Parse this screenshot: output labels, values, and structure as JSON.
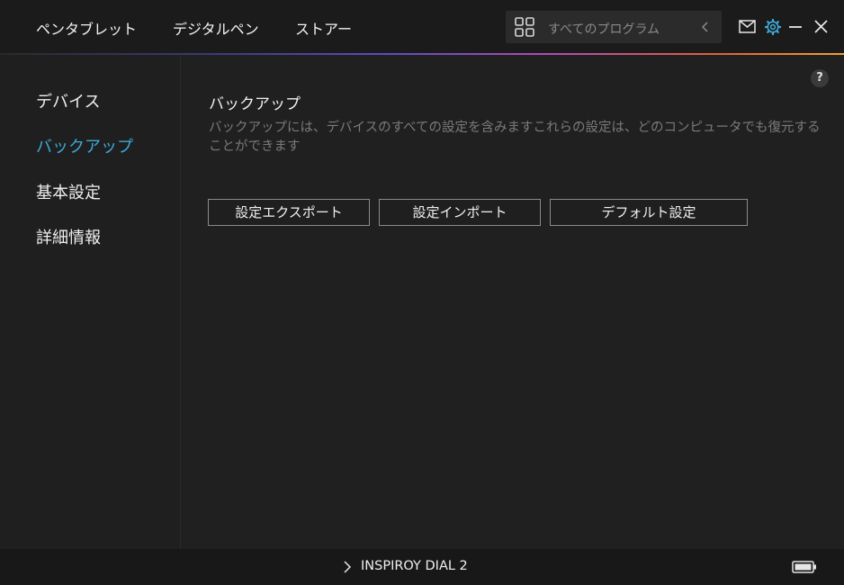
{
  "header": {
    "tabs": [
      {
        "label": "ペンタブレット"
      },
      {
        "label": "デジタルペン"
      },
      {
        "label": "ストアー"
      }
    ],
    "search": {
      "placeholder": "すべてのプログラム"
    },
    "icons": [
      "grid-icon",
      "chevron-left-icon",
      "mail-icon",
      "gear-icon",
      "minimize-icon",
      "close-icon"
    ],
    "accent_color": "#3ea8d8"
  },
  "sidebar": {
    "items": [
      {
        "label": "デバイス",
        "active": false
      },
      {
        "label": "バックアップ",
        "active": true
      },
      {
        "label": "基本設定",
        "active": false
      },
      {
        "label": "詳細情報",
        "active": false
      }
    ]
  },
  "main": {
    "help_label": "?",
    "title": "バックアップ",
    "description": "バックアップには、デバイスのすべての設定を含みますこれらの設定は、どのコンピュータでも復元することができます",
    "buttons": {
      "export": "設定エクスポート",
      "import": "設定インポート",
      "default": "デフォルト設定"
    }
  },
  "footer": {
    "device_name": "INSPIROY DIAL 2",
    "icons": [
      "chevron-right-icon",
      "battery-icon"
    ]
  }
}
